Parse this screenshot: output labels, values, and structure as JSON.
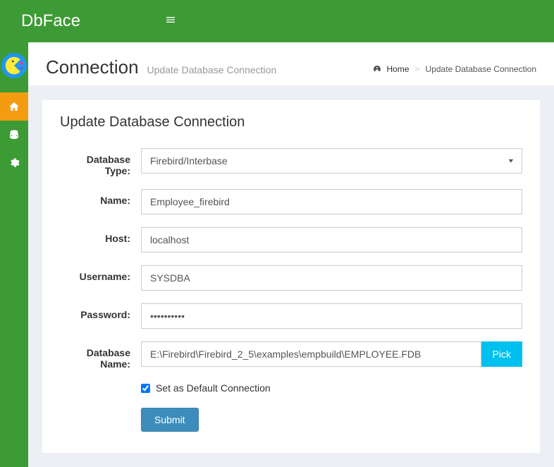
{
  "brand": "DbFace",
  "header": {
    "title": "Connection",
    "subtitle": "Update Database Connection"
  },
  "breadcrumb": {
    "home": "Home",
    "current": "Update Database Connection"
  },
  "panel": {
    "title": "Update Database Connection"
  },
  "form": {
    "db_type_label": "Database Type:",
    "db_type_value": "Firebird/Interbase",
    "name_label": "Name:",
    "name_value": "Employee_firebird",
    "host_label": "Host:",
    "host_value": "localhost",
    "username_label": "Username:",
    "username_value": "SYSDBA",
    "password_label": "Password:",
    "password_value": "••••••••••",
    "dbname_label": "Database Name:",
    "dbname_value": "E:\\Firebird\\Firebird_2_5\\examples\\empbuild\\EMPLOYEE.FDB",
    "pick_label": "Pick",
    "default_label": "Set as Default Connection",
    "default_checked": true,
    "submit_label": "Submit"
  }
}
